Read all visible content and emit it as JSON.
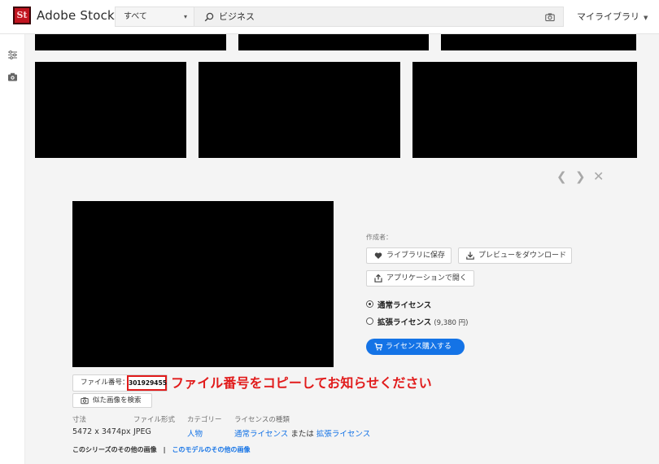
{
  "header": {
    "logo_text": "St",
    "brand": "Adobe Stock",
    "filter_value": "すべて",
    "search_query": "ビジネス",
    "library_menu": "マイライブラリ"
  },
  "detail": {
    "author_label": "作成者：",
    "actions": {
      "save_library": "ライブラリに保存",
      "download_preview": "プレビューをダウンロード",
      "open_in_app": "アプリケーションで開く"
    },
    "licenses": {
      "standard": "通常ライセンス",
      "extended": "拡張ライセンス",
      "extended_price": "(9,380 円)"
    },
    "buy_button": "ライセンス購入する",
    "file_number_label": "ファイル番号：",
    "file_number": "301929455",
    "annotation": "ファイル番号をコピーしてお知らせください",
    "find_similar": "似た画像を検索",
    "meta": {
      "size_label": "寸法",
      "size_value": "5472 x 3474px",
      "format_label": "ファイル形式",
      "format_value": "JPEG",
      "category_label": "カテゴリー",
      "category_value": "人物",
      "license_type_label": "ライセンスの種類",
      "license_standard": "通常ライセンス",
      "license_or": "または",
      "license_extended": "拡張ライセンス"
    },
    "series_link": "このシリーズのその他の画像",
    "separator": "|",
    "model_link": "このモデルのその他の画像"
  },
  "colors": {
    "accent_blue": "#1473e6",
    "annotation_red": "#e11b1b",
    "logo_red": "#c1141f"
  },
  "icons": [
    "adobe-stock-logo",
    "search-icon",
    "camera-icon",
    "filter-icon",
    "chevron-left-icon",
    "chevron-right-icon",
    "close-icon",
    "heart-icon",
    "download-icon",
    "share-icon",
    "cart-icon"
  ]
}
